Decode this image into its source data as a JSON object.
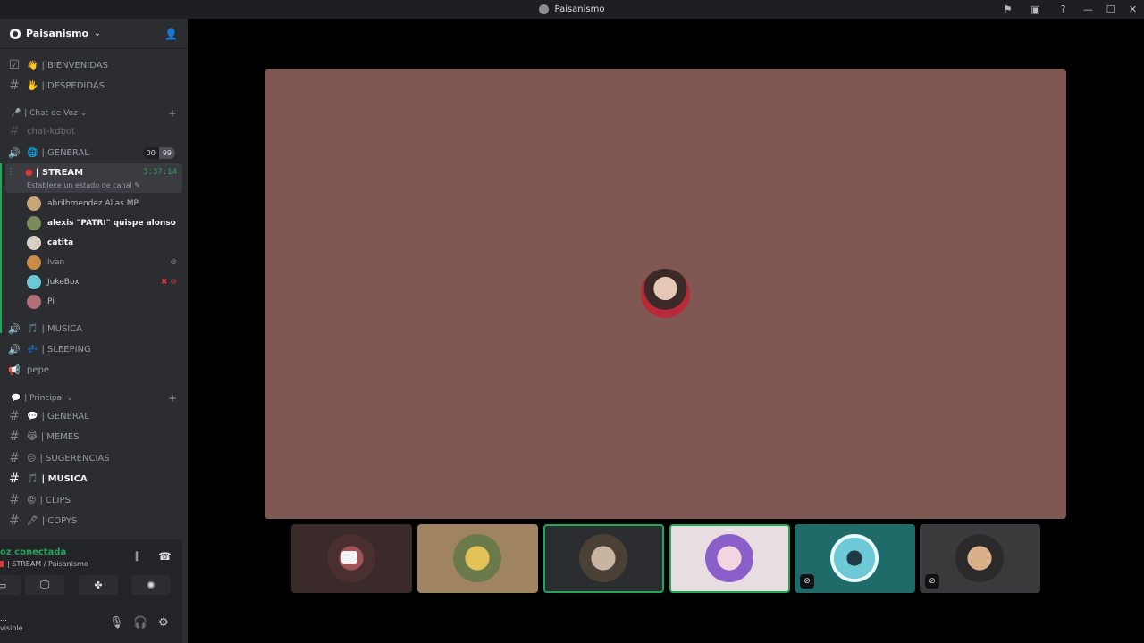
{
  "titlebar": {
    "title": "Paisanismo"
  },
  "guild": {
    "name": "Paisanismo"
  },
  "channels_top": [
    {
      "emoji": "👋",
      "label": "| BIENVENIDAS",
      "icon": "rules-icon"
    },
    {
      "emoji": "🖐",
      "label": "| DESPEDIDAS",
      "icon": "hash-icon"
    }
  ],
  "cat_voice": {
    "label": "| Chat de Voz"
  },
  "chat_kdbot": "chat-kdbot",
  "general_voice": {
    "label": "| GENERAL",
    "count_a": "00",
    "count_b": "99"
  },
  "stream": {
    "label": "| STREAM",
    "timer": "3:37:14",
    "status": "Establece un estado de canal"
  },
  "members": [
    {
      "name": "abrilhmendez Alias MP",
      "color": "#c7a67a"
    },
    {
      "name": "alexis \"PATRI\" quispe alonso",
      "color": "#7a8c5a"
    },
    {
      "name": "catita",
      "color": "#d9d0c4"
    },
    {
      "name": "Ivan",
      "color": "#c98c4a"
    },
    {
      "name": "JukeBox",
      "color": "#6ec9d6"
    },
    {
      "name": "Pi",
      "color": "#b0707a"
    }
  ],
  "voice_channels": [
    {
      "emoji": "🎵",
      "label": "| MUSICA"
    },
    {
      "emoji": "💤",
      "label": "| SLEEPING"
    },
    {
      "emoji": "",
      "label": "pepe"
    }
  ],
  "cat_principal": {
    "label": "| Principal"
  },
  "text_channels": [
    {
      "emoji": "💬",
      "label": "| GENERAL"
    },
    {
      "emoji": "😹",
      "label": "| MEMES"
    },
    {
      "emoji": "😕",
      "label": "| SUGERENCIAS"
    },
    {
      "emoji": "🎵",
      "label": "| MUSICA"
    },
    {
      "emoji": "😡",
      "label": "| CLIPS"
    },
    {
      "emoji": "🖊",
      "label": "| COPYS"
    }
  ],
  "voice_panel": {
    "status": "oz conectada",
    "channel": "| STREAM / Paisanismo"
  },
  "user": {
    "name": "...",
    "status": "visible"
  },
  "colors": {
    "accent_green": "#23a55a",
    "stage_bg": "#7f5753"
  },
  "tiles": [
    {
      "bg": "#3a2a2a",
      "avatar": "#7b3b3b",
      "icon": "camera-icon"
    },
    {
      "bg": "#a08462",
      "avatar": "#b39b45",
      "icon": ""
    },
    {
      "bg": "#2b2d31",
      "avatar": "#8a7a6a",
      "icon": ""
    },
    {
      "bg": "#e8dde1",
      "avatar": "#b59ad6",
      "icon": ""
    },
    {
      "bg": "#1f6b6a",
      "avatar": "#6ec9d6",
      "icon": "mic-off-icon"
    },
    {
      "bg": "#3a3a3c",
      "avatar": "#c98c4a",
      "icon": "mic-off-icon"
    }
  ]
}
